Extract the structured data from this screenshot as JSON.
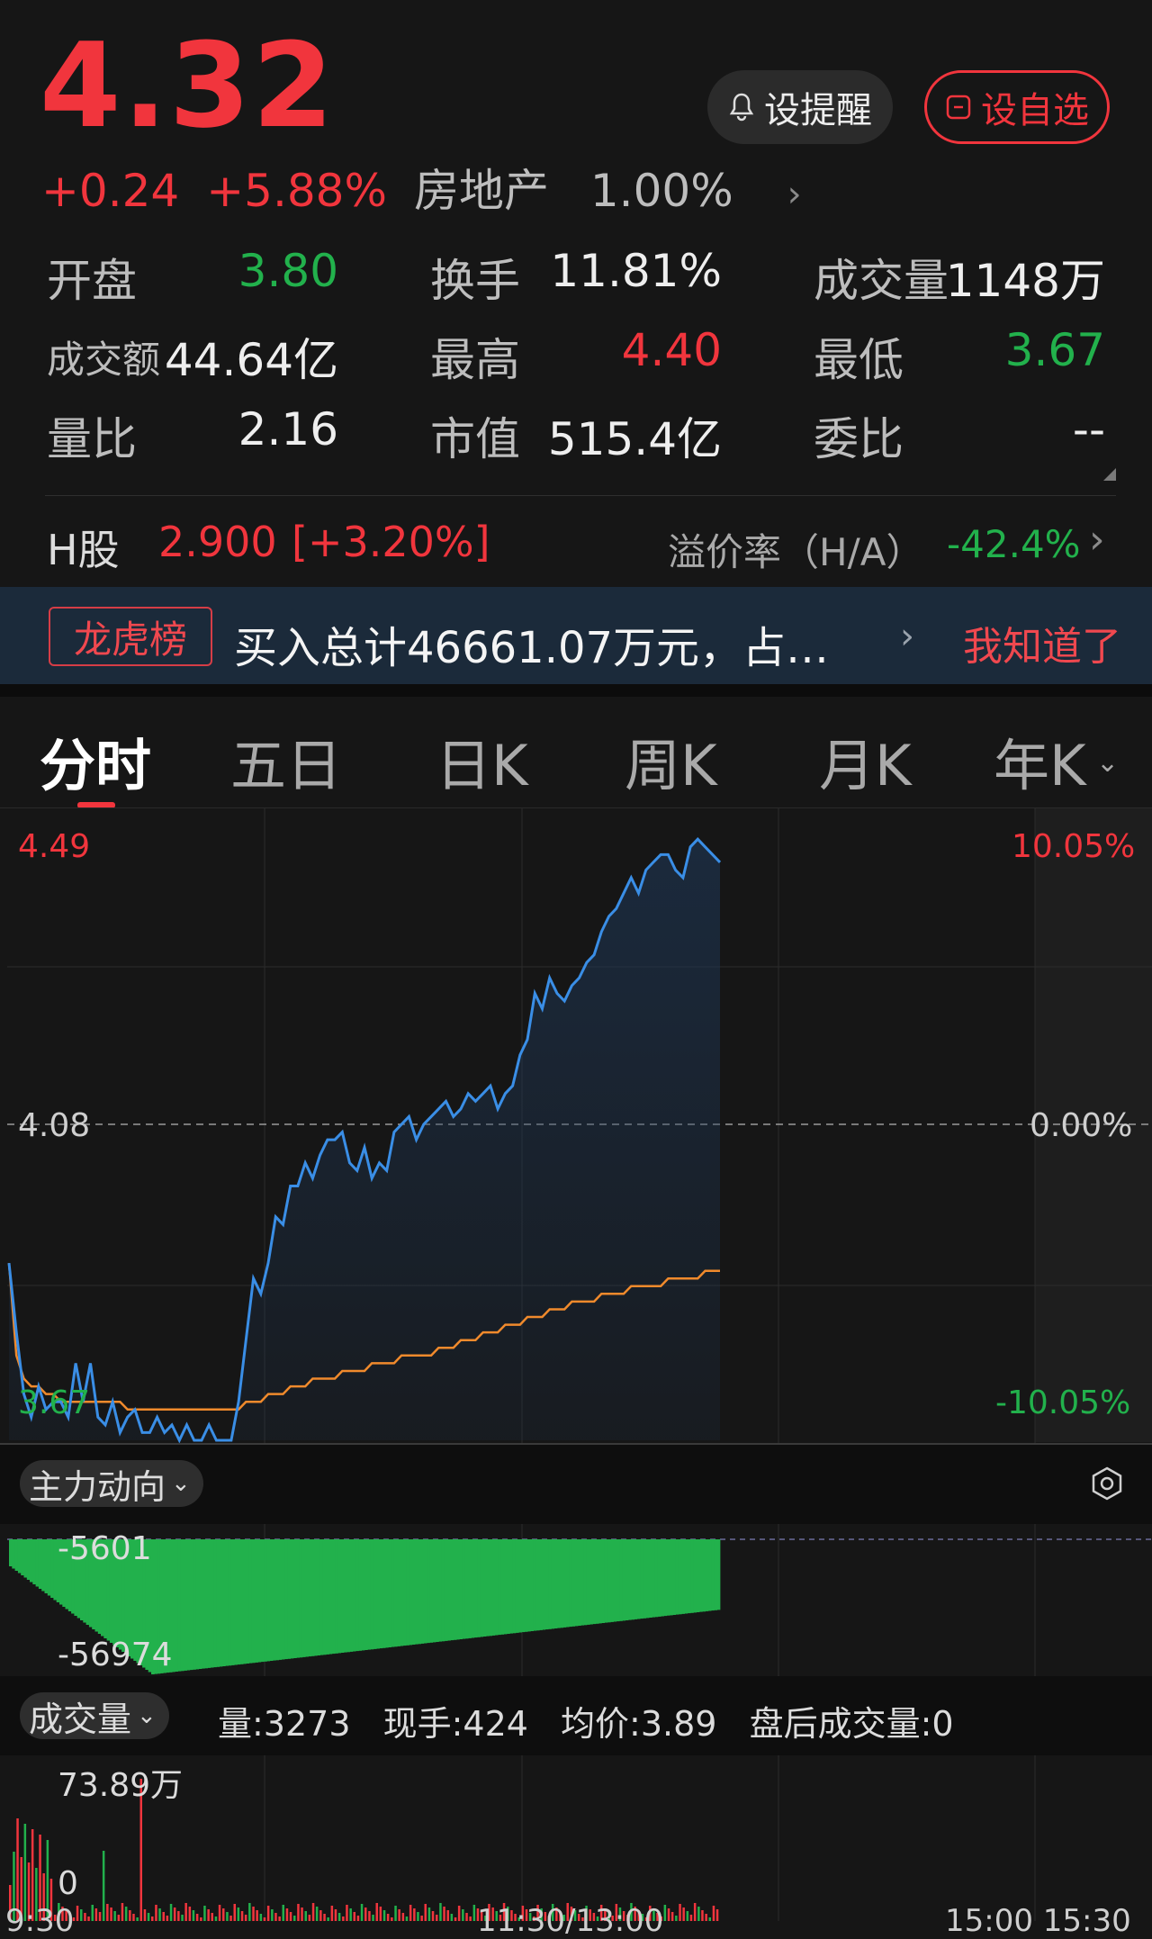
{
  "quote": {
    "price": "4.32",
    "change": "+0.24",
    "change_pct": "+5.88%",
    "sector_name": "房地产",
    "sector_pct": "1.00%"
  },
  "actions": {
    "alert_label": "设提醒",
    "watch_label": "设自选"
  },
  "stats": {
    "open_label": "开盘",
    "open": "3.80",
    "turnover_label": "换手",
    "turnover": "11.81%",
    "volume_label": "成交量",
    "volume": "1148万",
    "amount_label": "成交额",
    "amount": "44.64亿",
    "high_label": "最高",
    "high": "4.40",
    "low_label": "最低",
    "low": "3.67",
    "vol_ratio_label": "量比",
    "vol_ratio": "2.16",
    "mktcap_label": "市值",
    "mktcap": "515.4亿",
    "committee_label": "委比",
    "committee": "--"
  },
  "hshare": {
    "label": "H股",
    "price": "2.900",
    "pct": "[+3.20%]",
    "premium_label": "溢价率（H/A）",
    "premium": "-42.4%"
  },
  "banner": {
    "tag": "龙虎榜",
    "text": "买入总计46661.07万元，占…",
    "close_label": "我知道了"
  },
  "tabs": [
    {
      "label": "分时",
      "active": true
    },
    {
      "label": "五日"
    },
    {
      "label": "日K"
    },
    {
      "label": "周K"
    },
    {
      "label": "月K"
    },
    {
      "label": "年K"
    }
  ],
  "price_axis": {
    "top_left": "4.49",
    "mid_left": "4.08",
    "bottom_left": "3.67",
    "top_right": "10.05%",
    "mid_right": "0.00%",
    "bottom_right": "-10.05%"
  },
  "main_flow": {
    "label": "主力动向",
    "top_value": "-5601",
    "bottom_value": "-56974"
  },
  "volume_panel": {
    "label": "成交量",
    "vol": "量:3273",
    "now_hand": "现手:424",
    "avg_price": "均价:3.89",
    "after_hours": "盘后成交量:0",
    "max_label": "73.89万",
    "zero_label": "0"
  },
  "time_axis": {
    "start": "9:30",
    "mid": "11:30/13:00",
    "end": "15:00 15:30"
  },
  "colors": {
    "up": "#f1353d",
    "down": "#22b14c",
    "price_line": "#3a8ee6",
    "avg_line": "#f08a2c"
  },
  "chart_data": {
    "type": "line",
    "ylim": [
      3.67,
      4.49
    ],
    "series": [
      {
        "values": [
          3.9,
          3.81,
          3.73,
          3.7,
          3.74,
          3.71,
          3.72,
          3.72,
          3.7,
          3.77,
          3.72,
          3.77,
          3.7,
          3.69,
          3.72,
          3.68,
          3.7,
          3.71,
          3.68,
          3.68,
          3.7,
          3.68,
          3.69,
          3.67,
          3.69,
          3.67,
          3.67,
          3.69,
          3.67,
          3.67,
          3.67,
          3.72,
          3.8,
          3.88,
          3.86,
          3.9,
          3.96,
          3.95,
          4.0,
          4.0,
          4.03,
          4.01,
          4.04,
          4.06,
          4.06,
          4.07,
          4.03,
          4.02,
          4.05,
          4.01,
          4.03,
          4.02,
          4.07,
          4.08,
          4.09,
          4.06,
          4.08,
          4.09,
          4.1,
          4.11,
          4.09,
          4.1,
          4.12,
          4.11,
          4.12,
          4.13,
          4.1,
          4.12,
          4.13,
          4.17,
          4.19,
          4.25,
          4.23,
          4.27,
          4.25,
          4.24,
          4.26,
          4.27,
          4.29,
          4.3,
          4.33,
          4.35,
          4.36,
          4.38,
          4.4,
          4.38,
          4.41,
          4.42,
          4.43,
          4.43,
          4.41,
          4.4,
          4.44,
          4.45,
          4.44,
          4.43,
          4.42
        ]
      },
      {
        "values": [
          3.9,
          3.78,
          3.75,
          3.74,
          3.74,
          3.73,
          3.73,
          3.72,
          3.72,
          3.72,
          3.72,
          3.72,
          3.72,
          3.72,
          3.72,
          3.72,
          3.71,
          3.71,
          3.71,
          3.71,
          3.71,
          3.71,
          3.71,
          3.71,
          3.71,
          3.71,
          3.71,
          3.71,
          3.71,
          3.71,
          3.71,
          3.71,
          3.72,
          3.72,
          3.72,
          3.73,
          3.73,
          3.73,
          3.74,
          3.74,
          3.74,
          3.75,
          3.75,
          3.75,
          3.75,
          3.76,
          3.76,
          3.76,
          3.76,
          3.77,
          3.77,
          3.77,
          3.77,
          3.78,
          3.78,
          3.78,
          3.78,
          3.78,
          3.79,
          3.79,
          3.79,
          3.8,
          3.8,
          3.8,
          3.81,
          3.81,
          3.81,
          3.82,
          3.82,
          3.82,
          3.83,
          3.83,
          3.83,
          3.84,
          3.84,
          3.84,
          3.85,
          3.85,
          3.85,
          3.85,
          3.86,
          3.86,
          3.86,
          3.86,
          3.87,
          3.87,
          3.87,
          3.87,
          3.87,
          3.88,
          3.88,
          3.88,
          3.88,
          3.88,
          3.89,
          3.89,
          3.89
        ]
      }
    ]
  }
}
